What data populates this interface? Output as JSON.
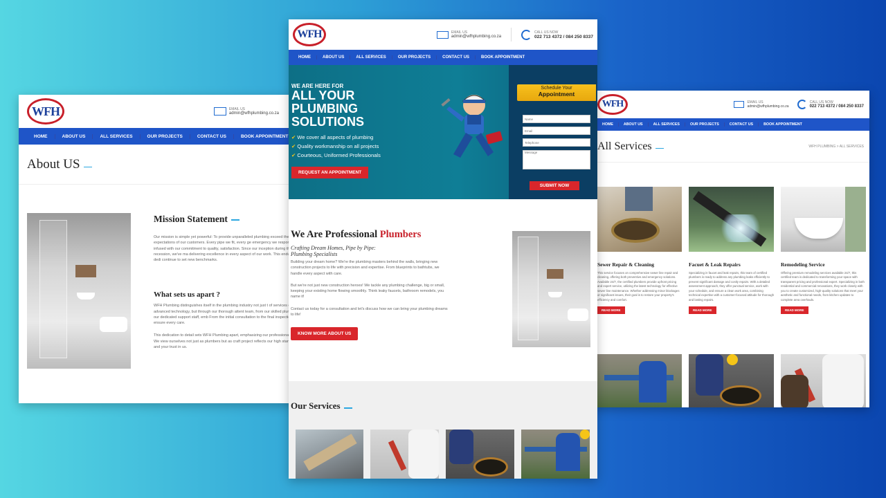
{
  "site": {
    "logo_text": "WFH",
    "logo_sub": "PLUMBING (PTY) Ltd",
    "email_label": "EMAIL US",
    "email": "admin@wfhplumbing.co.za",
    "call_label": "CALL US NOW",
    "phones": "022 713 4372 / 084 250 8337"
  },
  "nav": [
    "HOME",
    "ABOUT US",
    "ALL SERVICES",
    "OUR PROJECTS",
    "CONTACT US",
    "BOOK APPOINTMENT"
  ],
  "about": {
    "title": "About US",
    "mission_title": "Mission Statement",
    "mission_text": "Our mission is simple yet powerful: To provide unparalleled plumbing exceed the expectations of our customers. Every pipe we fit, every ge emergency we respond to is infused with our commitment to quality, satisfaction. Since our inception during the 2009 recession, we've ma delivering excellence in every aspect of our work. This enduring dedi continue to set new benchmarks.",
    "apart_title": "What sets us apart ?",
    "apart_text": "WFH Plumbing distinguishes itself in the plumbing industry not just t of services or advanced technology, but through our thorough attent team, from our skilled plumbers to our dedicated support staff, emb From the initial consultation to the final inspection, we ensure every care.",
    "apart_text2": "This dedication to detail sets WFH Plumbing apart, emphasizing our professionalism. We view ourselves not just as plumbers but as craft project reflects our high standards and your trust in us."
  },
  "home": {
    "hero_small": "WE ARE HERE FOR",
    "hero_big_1": "ALL YOUR",
    "hero_big_2": "PLUMBING",
    "hero_big_3": "SOLUTIONS",
    "bullets": [
      "We cover all aspects of plumbing",
      "Quality workmanship on all projects",
      "Courteous, Uniformed Professionals"
    ],
    "cta": "REQUEST AN APPOINTMENT",
    "form_title_1": "Schedule Your",
    "form_title_2": "Appointment",
    "form_fields": [
      "Name",
      "Email",
      "Telephone",
      "Message"
    ],
    "submit": "SUBMIT NOW",
    "pro_title_1": "We Are Professional",
    "pro_title_2": "Plumbers",
    "pro_sub": "Crafting Dream Homes, Pipe by Pipe: Plumbing Specialists",
    "pro_p1": "Building your dream home? We're the plumbing masters behind the walls, bringing new construction projects to life with precision and expertise. From blueprints to bathtubs, we handle every aspect with care.",
    "pro_p2": "But we're not just new construction heroes! We tackle any plumbing challenge, big or small, keeping your existing home flowing smoothly. Think leaky faucets, bathroom remodels, you name it!",
    "pro_p3": "Contact us today for a consultation and let's discuss how we can bring your plumbing dreams to life!",
    "know_more": "KNOW MORE ABOUT US",
    "services_title": "Our Services"
  },
  "services": {
    "title": "All Services",
    "breadcrumb": "WFH PLUMBING > ALL SERVICES",
    "items": [
      {
        "title": "Sewer Repair & Cleaning",
        "text": "This service focuses on comprehensive sewer line repair and cleaning, offering both preventive and emergency solutions. Available 24/7, the certified plumbers provide upfront pricing and expert service, utilizing the latest technology for effective sewer line maintenance. Whether addressing minor blockages or significant issues, their goal is to restore your property's efficiency and comfort."
      },
      {
        "title": "Facuet & Leak Repairs",
        "text": "Specializing in faucet and leak repairs, this team of certified plumbers is ready to address any plumbing leaks efficiently to prevent significant damage and costly repairs. With a detailed assessment approach, they offer punctual service, work with your schedule, and ensure a clean work area, combining technical expertise with a customer-focused attitude for thorough and lasting repairs."
      },
      {
        "title": "Remodeling Service",
        "text": "Offering premium remodeling services available 24/7, this certified team is dedicated to transforming your space with transparent pricing and professional expert. Specializing in both residential and commercial renovations, they work closely with you to create customized, high-quality solutions that meet your aesthetic and functional needs, from kitchen updates to complete area overhauls."
      }
    ],
    "read_more": "READ MORE"
  }
}
